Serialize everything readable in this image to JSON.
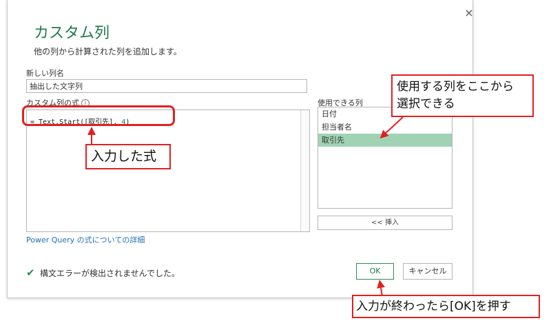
{
  "dialog": {
    "title": "カスタム列",
    "description": "他の列から計算された列を追加します。",
    "close_icon": "×",
    "new_column_label": "新しい列名",
    "new_column_value": "抽出した文字列",
    "formula_label": "カスタム列の式",
    "info_icon": "i",
    "formula_text": "= Text.Start([取引先], ",
    "formula_num": "4",
    "formula_end": ")",
    "available_label": "使用できる列",
    "columns": [
      "日付",
      "担当者名",
      "取引先"
    ],
    "insert_button": "<< 挿入",
    "help_link": "Power Query の式についての詳細",
    "check_icon": "✔",
    "status": "構文エラーが検出されませんでした。",
    "ok_button": "OK",
    "cancel_button": "キャンセル"
  },
  "annotations": {
    "formula_callout": "入力した式",
    "columns_callout_line1": "使用する列をここから",
    "columns_callout_line2": "選択できる",
    "ok_callout": "入力が終わったら[OK]を押す"
  },
  "colors": {
    "accent": "#1f7a4d",
    "selection": "#9fd3b4",
    "highlight": "#e02020",
    "link": "#1f6fb5"
  }
}
